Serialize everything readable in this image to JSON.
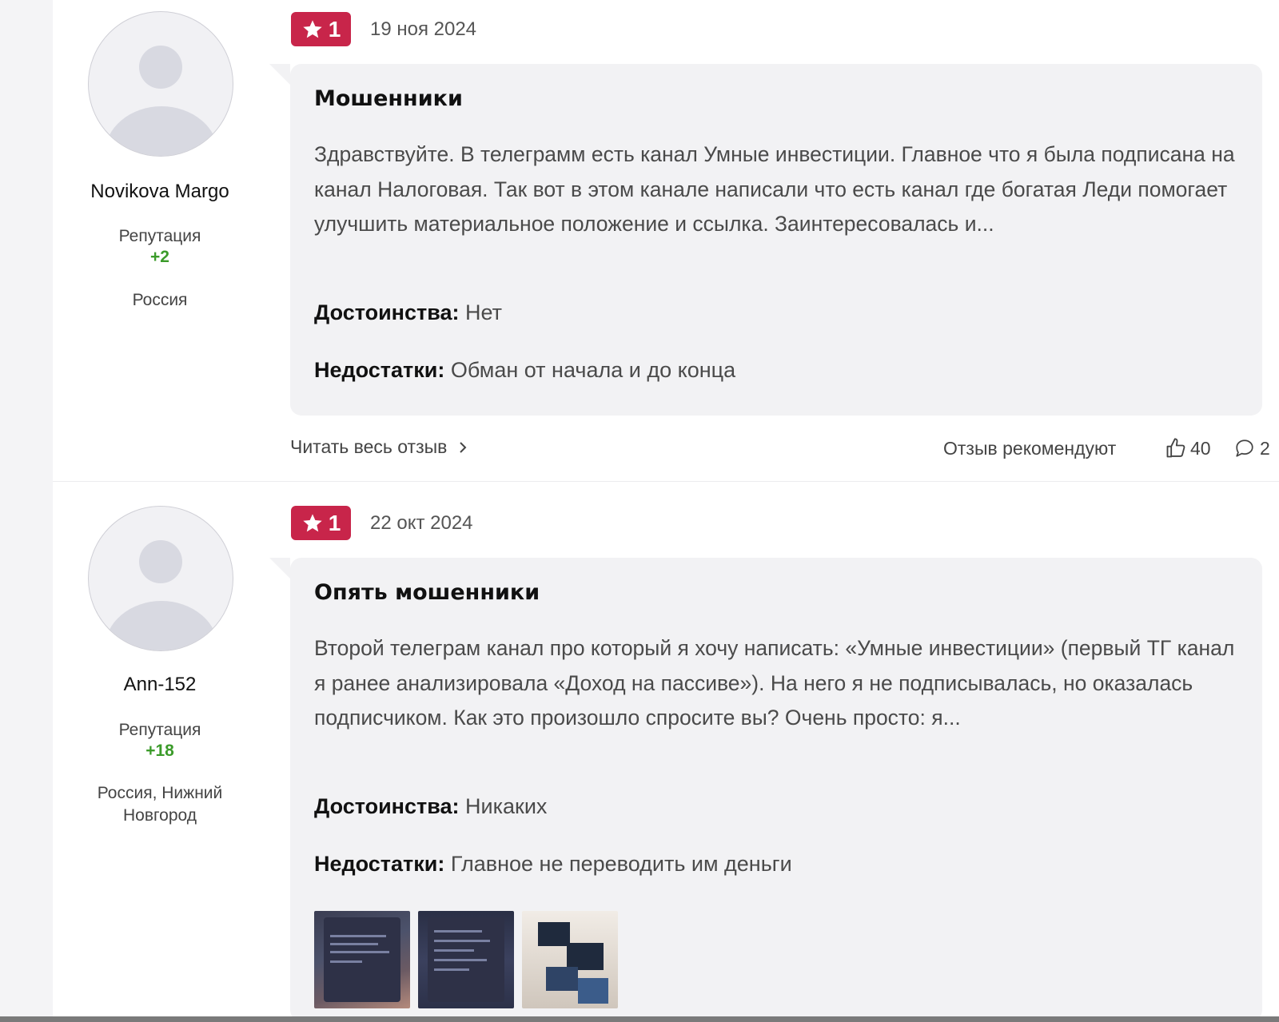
{
  "reviews": [
    {
      "author": "Novikova Margo",
      "reputation_label": "Репутация",
      "reputation_value": "+2",
      "location": "Россия",
      "rating": "1",
      "date": "19 ноя 2024",
      "title": "Мошенники",
      "text": "Здравствуйте. В телеграмм есть канал Умные инвестиции. Главное что я была подписана на канал Налоговая. Так вот в этом канале написали что есть канал где богатая Леди помогает улучшить материальное положение и ссылка. Заинтересовалась и...",
      "pros_label": "Достоинства:",
      "pros": "Нет",
      "cons_label": "Недостатки:",
      "cons": "Обман от начала и до конца",
      "read_more": "Читать весь отзыв",
      "recommend_label": "Отзыв рекомендуют",
      "likes": "40",
      "comments": "2"
    },
    {
      "author": "Ann-152",
      "reputation_label": "Репутация",
      "reputation_value": "+18",
      "location": "Россия, Нижний Новгород",
      "rating": "1",
      "date": "22 окт 2024",
      "title": "Опять мошенники",
      "text": "Второй телеграм канал про который я хочу написать: «Умные инвестиции» (первый ТГ канал я ранее анализировала «Доход на пассиве»). На него я не подписывалась, но оказалась подписчиком. Как это произошло спросите вы? Очень просто: я...",
      "pros_label": "Достоинства:",
      "pros": "Никаких",
      "cons_label": "Недостатки:",
      "cons": "Главное не переводить им деньги"
    }
  ],
  "colors": {
    "rating_badge": "#c8254a",
    "reputation": "#3b9b2a",
    "bubble": "#f2f2f4"
  },
  "icons": {
    "rating": "star-icon",
    "read_more": "chevron-right-icon",
    "likes": "thumbs-up-icon",
    "comments": "comment-icon"
  }
}
